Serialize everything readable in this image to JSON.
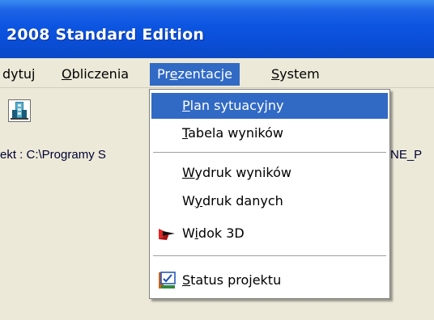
{
  "window": {
    "title": "2008 Standard Edition"
  },
  "menubar": {
    "items": [
      {
        "label": "dytuj",
        "active": false
      },
      {
        "label": "Obliczenia",
        "mnemonic": "O",
        "active": false
      },
      {
        "label": "Prezentacje",
        "mnemonic": "z",
        "active": true
      },
      {
        "label": "System",
        "mnemonic": "S",
        "active": false
      }
    ]
  },
  "toolbar": {
    "button_icon": "building-icon"
  },
  "status": {
    "project_text": "ekt : C:\\Programy S",
    "project_suffix": "NE_P"
  },
  "dropdown": {
    "items": [
      {
        "label": "Plan sytuacyjny",
        "mnemonic": "P",
        "highlight": true
      },
      {
        "label": "Tabela wyników",
        "mnemonic": "T"
      },
      {
        "separator": true
      },
      {
        "label": "Wydruk wyników",
        "mnemonic": "W"
      },
      {
        "label": "Wydruk danych",
        "mnemonic": "y"
      },
      {
        "label": "Widok 3D",
        "mnemonic": "i",
        "icon": "3d-view-icon"
      },
      {
        "separator": true
      },
      {
        "label": "Status projektu",
        "mnemonic": "S",
        "icon": "status-icon"
      }
    ]
  },
  "colors": {
    "titlebar": "#0a4ed8",
    "highlight": "#316ac5",
    "menu_bg": "#ece9d8"
  }
}
